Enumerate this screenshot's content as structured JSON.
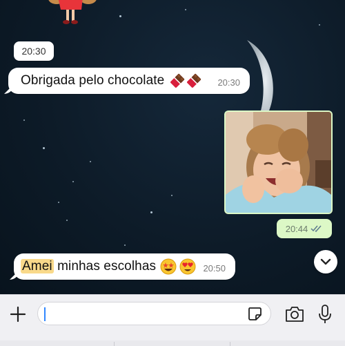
{
  "date_chip": {
    "label": "20:30"
  },
  "messages": [
    {
      "text": "Obrigada pelo chocolate",
      "emoji": [
        "chocolate-bar-icon",
        "chocolate-bar-icon"
      ],
      "time": "20:30"
    },
    {
      "type": "photo",
      "subject": "laughing-child-photo",
      "time": "20:44",
      "status": "read-double-check-icon"
    },
    {
      "highlight": "Amei",
      "text": " minhas escolhas",
      "emoji": [
        "star-struck-face-icon",
        "heart-eyes-face-icon"
      ],
      "time": "20:50"
    }
  ],
  "composer": {
    "placeholder": "",
    "value": ""
  },
  "colors": {
    "bubble_in": "#ffffff",
    "bubble_out": "#dcf8c6",
    "highlight": "#f9d98a",
    "accent": "#2f86ff"
  }
}
